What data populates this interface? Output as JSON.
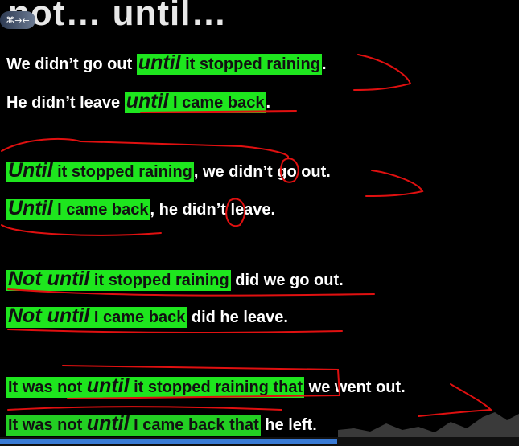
{
  "title": {
    "text": "not… until…",
    "logo_label": "⌘→←"
  },
  "sentences": [
    {
      "before": "We didn’t go out ",
      "highlight_kw": "until",
      "highlight_rest": " it stopped raining",
      "after": "."
    },
    {
      "before": "He didn’t leave ",
      "highlight_kw": "until",
      "highlight_rest": " I came back",
      "after": "."
    },
    {
      "before": "",
      "highlight_kw": "Until",
      "highlight_rest": " it stopped raining",
      "after": ", we didn’t go out."
    },
    {
      "before": "",
      "highlight_kw": "Until",
      "highlight_rest": " I came back",
      "after": ", he didn’t leave."
    },
    {
      "before": "",
      "highlight_kw": "Not until",
      "highlight_rest": " it stopped raining",
      "after": " did we go out."
    },
    {
      "before": "",
      "highlight_kw": "Not until",
      "highlight_rest": " I came back",
      "after": " did he leave."
    },
    {
      "before": "",
      "highlight_pre": "It was not ",
      "highlight_kw": "until",
      "highlight_rest": " it stopped raining that",
      "after": " we went out."
    },
    {
      "before": "",
      "highlight_pre": "It was not ",
      "highlight_kw": "until",
      "highlight_rest": " I came back that",
      "after": " he left."
    }
  ],
  "colors": {
    "background": "#000000",
    "highlight": "#1ee61e",
    "ink_annotation": "#e01010",
    "text": "#ffffff"
  },
  "playback": {
    "progress_fraction": 0.65
  }
}
